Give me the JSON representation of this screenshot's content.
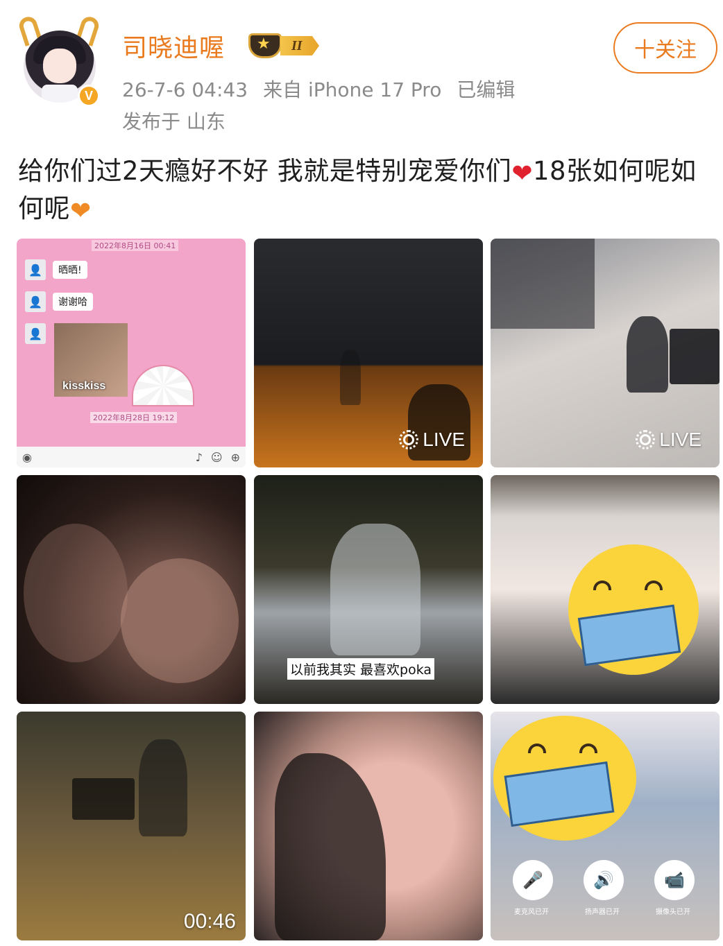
{
  "user": {
    "name": "司晓迪喔",
    "level_badge": "II",
    "verified_mark": "V"
  },
  "meta": {
    "time": "26-7-6 04:43",
    "source": "来自 iPhone 17 Pro",
    "edited": "已编辑",
    "location": "发布于 山东"
  },
  "follow": {
    "label": "十关注"
  },
  "post": {
    "text_part1": "给你们过2天瘾好不好 我就是特别宠爱你们",
    "heart1": "❤",
    "text_part2": "18张如何呢如何呢",
    "heart2": "❤"
  },
  "tiles": {
    "chat": {
      "top_timestamp": "2022年8月16日 00:41",
      "msg1": "晒晒!",
      "msg2": "谢谢哈",
      "sticker_label": "kisskiss",
      "sticker_timestamp": "2022年8月28日 19:12"
    },
    "live_label": "LIVE",
    "subtitle": "以前我其实 最喜欢poka",
    "video_duration": "00:46",
    "call": {
      "mute_label": "麦克风已开",
      "speaker_label": "扬声器已开",
      "camera_label": "摄像头已开"
    }
  },
  "icons": {
    "avatar": "avatar-anime",
    "crown": "crown-icon",
    "live": "live-photo-icon",
    "mic": "mic-icon",
    "speaker": "speaker-icon",
    "camera": "camera-icon"
  },
  "colors": {
    "brand_orange": "#ea7a1e",
    "meta_gray": "#8a8a8a",
    "text": "#1f1f1f"
  }
}
